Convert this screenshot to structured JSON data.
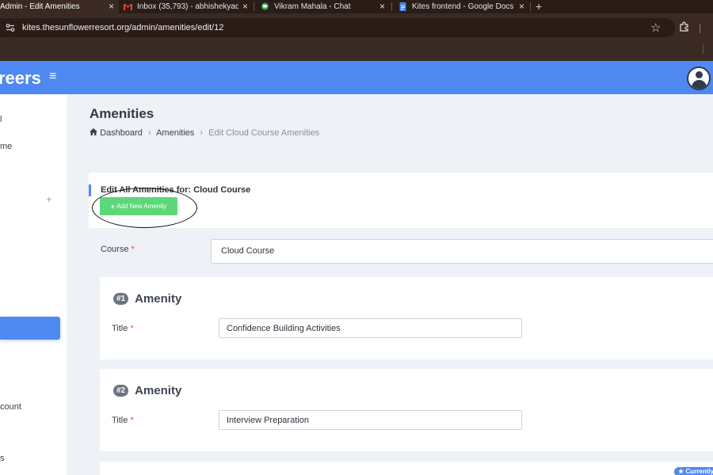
{
  "browser": {
    "tabs": [
      {
        "title": "Admin - Edit Amenities",
        "close": "×"
      },
      {
        "title": "Inbox (35,793) - abhishekyad",
        "close": "×"
      },
      {
        "title": "Vikram Mahala - Chat",
        "close": "×"
      },
      {
        "title": "Kites frontend - Google Docs",
        "close": "×"
      }
    ],
    "new_tab": "+",
    "url": "kites.thesunflowerresort.org/admin/amenities/edit/12"
  },
  "header": {
    "brand": "reers",
    "menu_icon": "≡"
  },
  "sidebar": {
    "items": [
      "l",
      "me",
      "count",
      "s"
    ],
    "expand": "+"
  },
  "page": {
    "title": "Amenities",
    "breadcrumb": {
      "home": "Dashboard",
      "section": "Amenities",
      "current": "Edit Cloud Course Amenities"
    }
  },
  "form": {
    "header_title": "Edit All Amenities for: Cloud Course",
    "add_button": "Add New Amenity",
    "course_label": "Course",
    "required_mark": "*",
    "course_value": "Cloud Course",
    "amenities": [
      {
        "number": "#1",
        "heading": "Amenity",
        "title_label": "Title",
        "title_value": "Confidence Building Activities"
      },
      {
        "number": "#2",
        "heading": "Amenity",
        "title_label": "Title",
        "title_value": "Interview Preparation"
      }
    ]
  },
  "badge": "Currently",
  "colors": {
    "accent": "#5088f2",
    "add_button": "#5dd879",
    "required": "#e74c3c",
    "browser_frame": "#3b2a23"
  }
}
